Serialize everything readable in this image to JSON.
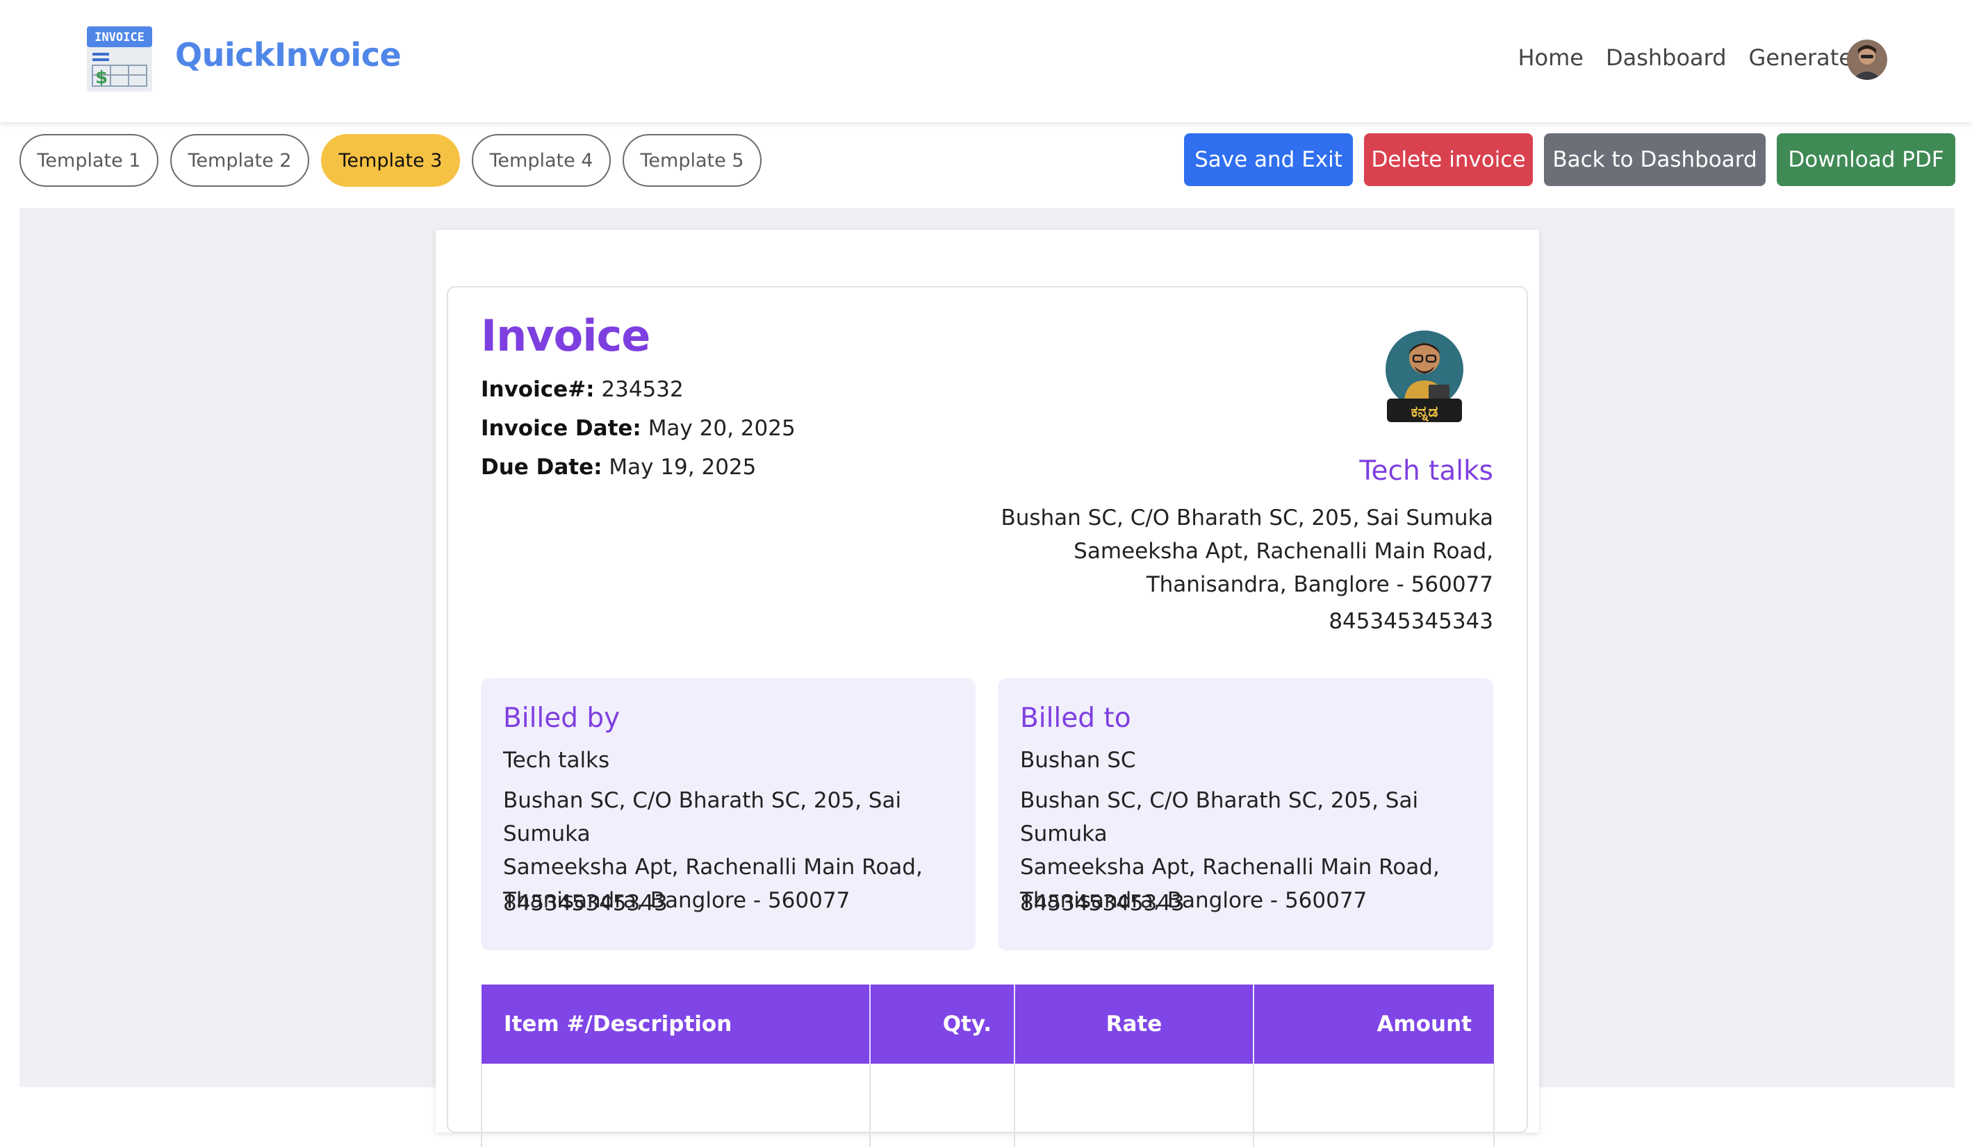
{
  "navbar": {
    "logo_text": "INVOICE",
    "brand": "QuickInvoice",
    "links": [
      "Home",
      "Dashboard",
      "Generate"
    ],
    "accent_color": "#4f86e8"
  },
  "toolbar": {
    "templates": [
      "Template 1",
      "Template 2",
      "Template 3",
      "Template 4",
      "Template 5"
    ],
    "active_template": "Template 3",
    "save_label": "Save and Exit",
    "delete_label": "Delete invoice",
    "back_label": "Back to Dashboard",
    "download_label": "Download PDF"
  },
  "invoice": {
    "title": "Invoice",
    "number_label": "Invoice#:",
    "number": "234532",
    "date_label": "Invoice Date:",
    "date": "May 20, 2025",
    "due_label": "Due Date:",
    "due": "May 19, 2025",
    "accent_color": "#7e3fe0"
  },
  "company": {
    "name": "Tech talks",
    "address_lines": [
      "Bushan SC, C/O Bharath SC, 205, Sai Sumuka",
      "Sameeksha Apt, Rachenalli Main Road,",
      "Thanisandra, Banglore - 560077"
    ],
    "phone": "845345345343",
    "logo_text": "ಕನ್ನಡ"
  },
  "billed_by": {
    "heading": "Billed by",
    "name": "Tech talks",
    "address_lines": [
      "Bushan SC, C/O Bharath SC, 205, Sai Sumuka",
      "Sameeksha Apt, Rachenalli Main Road,",
      "Thanisandra, Banglore - 560077"
    ],
    "phone": "845345345343"
  },
  "billed_to": {
    "heading": "Billed to",
    "name": "Bushan SC",
    "address_lines": [
      "Bushan SC, C/O Bharath SC, 205, Sai Sumuka",
      "Sameeksha Apt, Rachenalli Main Road,",
      "Thanisandra, Banglore - 560077"
    ],
    "phone": "845345345343"
  },
  "items_table": {
    "headers": [
      "Item #/Description",
      "Qty.",
      "Rate",
      "Amount"
    ],
    "header_color": "#7f45e6"
  }
}
